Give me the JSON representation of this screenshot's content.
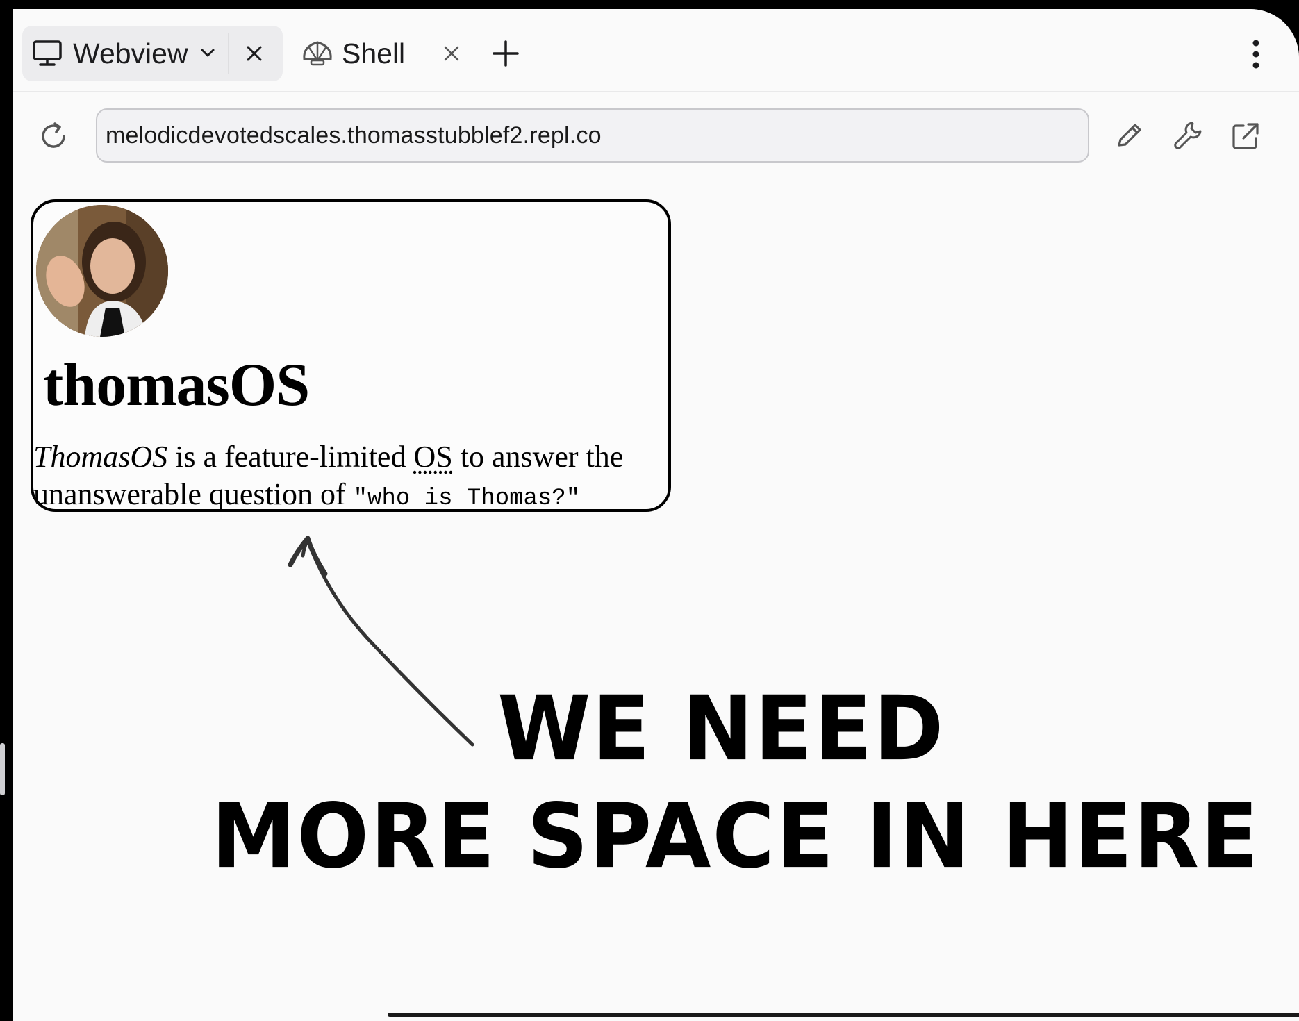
{
  "tabs": [
    {
      "label": "Webview",
      "icon": "monitor-icon",
      "active": true
    },
    {
      "label": "Shell",
      "icon": "shell-icon",
      "active": false
    }
  ],
  "toolbar": {
    "url": "melodicdevotedscales.thomasstubblef2.repl.co"
  },
  "card": {
    "title": "thomasOS",
    "desc_italic": "ThomasOS",
    "desc_part1": " is a feature-limited ",
    "desc_abbr": "OS",
    "desc_part2": " to answer the unanswerable question of ",
    "desc_code": "\"who is Thomas?\""
  },
  "annotation": {
    "line1": "WE NEED",
    "line2": "MORE SPACE IN HERE"
  }
}
